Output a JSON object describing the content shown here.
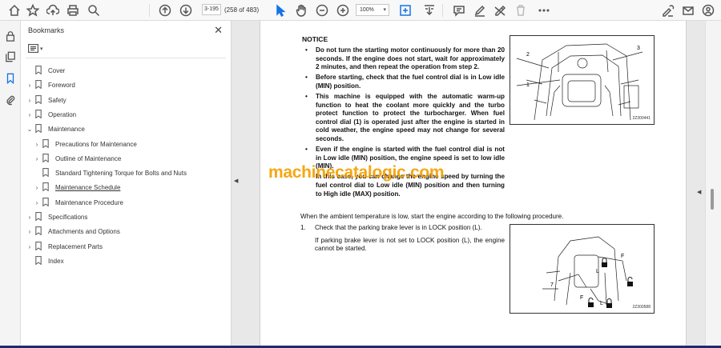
{
  "toolbar": {
    "page_number": "3-195",
    "page_count": "(258 of 483)",
    "zoom": "100%"
  },
  "bookmarks": {
    "title": "Bookmarks",
    "close_glyph": "✕",
    "items": [
      {
        "label": "Cover",
        "chevron": ""
      },
      {
        "label": "Foreword",
        "chevron": "›"
      },
      {
        "label": "Safety",
        "chevron": "›"
      },
      {
        "label": "Operation",
        "chevron": "›"
      },
      {
        "label": "Maintenance",
        "chevron": "⌄"
      },
      {
        "label": "Precautions for Maintenance",
        "chevron": "›"
      },
      {
        "label": "Outline of Maintenance",
        "chevron": "›"
      },
      {
        "label": "Standard Tightening Torque for Bolts and Nuts",
        "chevron": ""
      },
      {
        "label": "Maintenance Schedule",
        "chevron": "›"
      },
      {
        "label": "Maintenance Procedure",
        "chevron": "›"
      },
      {
        "label": "Specifications",
        "chevron": "›"
      },
      {
        "label": "Attachments and Options",
        "chevron": "›"
      },
      {
        "label": "Replacement Parts",
        "chevron": "›"
      },
      {
        "label": "Index",
        "chevron": ""
      }
    ]
  },
  "document": {
    "notice_heading": "NOTICE",
    "notice_items": [
      "Do not turn the starting motor continuously for more than 20 seconds. If the engine does not start, wait for approximately 2 minutes, and then repeat the operation from step 2.",
      "Before starting, check that the fuel control dial is in Low idle (MIN) position.",
      "This machine is equipped with the automatic warm-up function to heat the coolant more quickly and the turbo protect function to protect the turbocharger. When fuel control dial (1) is operated just after the engine is started in cold weather, the engine speed may not change for several seconds.",
      "Even if the engine is started with the fuel control dial is not in Low idle (MIN) position, the engine speed is set to low idle (MIN)."
    ],
    "notice_followup": "In this case, you can change the engine speed by turning the fuel control dial to Low idle (MIN) position and then turning to High idle (MAX) position.",
    "cold_intro": "When the ambient temperature is low, start the engine according to the following procedure.",
    "step_number": "1.",
    "step_text": "Check that the parking brake lever is in LOCK position (L).",
    "step_note": "If parking brake lever is not set to LOCK position (L), the engine cannot be started.",
    "figure1": {
      "code": "2Z300441",
      "labels": [
        "2",
        "3",
        "1"
      ]
    },
    "figure2": {
      "code": "2Z300588",
      "labels": [
        "F",
        "L",
        "F",
        "L",
        "7"
      ]
    },
    "watermark": "machinecatalogic.com"
  }
}
